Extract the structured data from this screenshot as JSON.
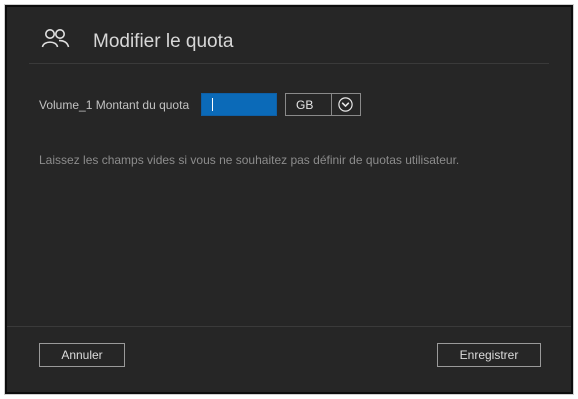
{
  "dialog": {
    "title": "Modifier le quota",
    "icon": "users-icon"
  },
  "quota": {
    "label": "Volume_1 Montant du quota",
    "value": "",
    "placeholder": "",
    "unit": {
      "selected": "GB",
      "icon": "chevron-down-circle-icon"
    }
  },
  "hint": "Laissez les champs vides si vous ne souhaitez pas définir de quotas utilisateur.",
  "footer": {
    "cancel_label": "Annuler",
    "save_label": "Enregistrer"
  },
  "colors": {
    "dialog_background": "#262626",
    "input_accent": "#0b6ab8",
    "text_primary": "#d7d7d7",
    "text_muted": "#8c8c8c"
  }
}
